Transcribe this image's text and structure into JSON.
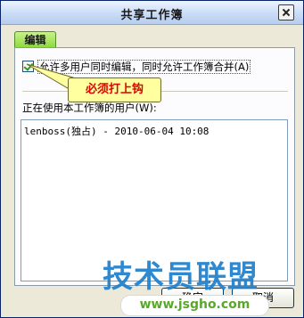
{
  "window": {
    "title": "共享工作簿"
  },
  "tabs": [
    {
      "label": "编辑"
    }
  ],
  "editing": {
    "allow_multi_user_label": "允许多用户同时编辑，同时允许工作簿合并",
    "allow_multi_user_shortcut": "(A)",
    "allow_multi_user_checked": true,
    "users_label": "正在使用本工作簿的用户(W):",
    "users": [
      "lenboss(独占) - 2010-06-04 10:08"
    ]
  },
  "annotation": {
    "callout_text": "必须打上钩"
  },
  "buttons": {
    "ok_label": "确定",
    "cancel_label": "取消"
  },
  "watermark": {
    "logo_text": "技术员联盟",
    "url_text": "www.jsgho.com"
  },
  "colors": {
    "title_bar": "#c9dcf7",
    "tab_green": "#8ad93a",
    "callout_bg": "#ffff9f",
    "callout_text": "#e10000",
    "watermark_blue": "#1f7fcc"
  },
  "icons": {
    "close": "close-icon",
    "checkbox": "checkmark-icon"
  }
}
